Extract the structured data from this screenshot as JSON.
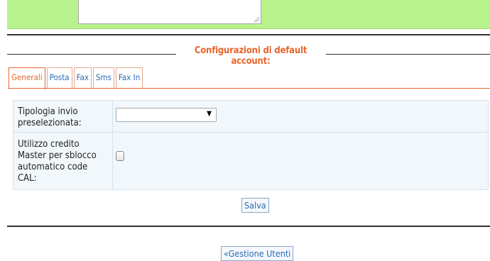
{
  "section_title": "Configurazioni di default account:",
  "tabs": [
    {
      "label": "Generali",
      "active": true
    },
    {
      "label": "Posta",
      "active": false
    },
    {
      "label": "Fax",
      "active": false
    },
    {
      "label": "Sms",
      "active": false
    },
    {
      "label": "Fax In",
      "active": false
    }
  ],
  "form": {
    "tipologia_label": "Tipologia invio preselezionata:",
    "tipologia_value": "",
    "utilizzo_label": "Utilizzo credito Master per sblocco automatico code CAL:",
    "utilizzo_checked": false
  },
  "save_label": "Salva",
  "back_label": "«Gestione Utenti",
  "colors": {
    "accent": "#e8652c",
    "link": "#2d6bb5",
    "top_band": "#b8f28c"
  }
}
